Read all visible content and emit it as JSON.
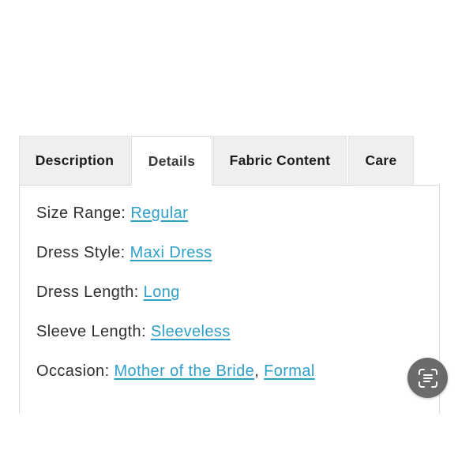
{
  "tabs": [
    {
      "label": "Description"
    },
    {
      "label": "Details"
    },
    {
      "label": "Fabric Content"
    },
    {
      "label": "Care"
    }
  ],
  "active_tab": "Details",
  "details": {
    "size_range": {
      "label": "Size Range:",
      "value": "Regular"
    },
    "dress_style": {
      "label": "Dress Style:",
      "value": "Maxi Dress"
    },
    "dress_length": {
      "label": "Dress Length:",
      "value": "Long"
    },
    "sleeve_length": {
      "label": "Sleeve Length:",
      "value": "Sleeveless"
    },
    "occasion": {
      "label": "Occasion:",
      "values": [
        "Mother of the Bride",
        "Formal"
      ],
      "separator": ","
    }
  },
  "fab": {
    "icon": "scan-text-icon"
  },
  "colors": {
    "link": "#2e9fc9",
    "tab_inactive_bg": "#efefef",
    "fab_bg": "#6b6b6b"
  }
}
